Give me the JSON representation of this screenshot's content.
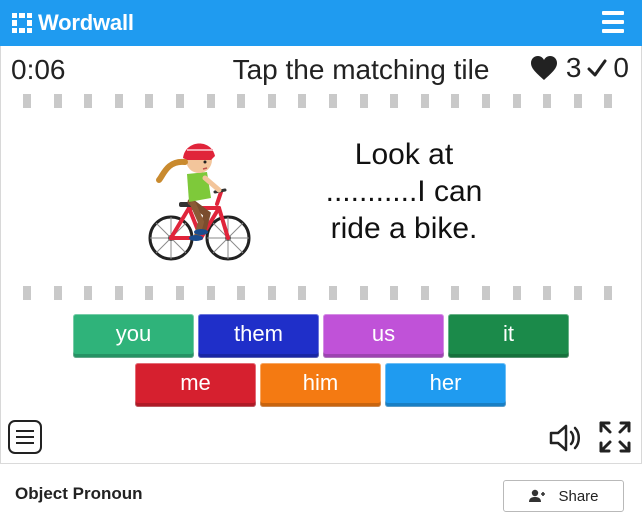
{
  "header": {
    "logo_text": "Wordwall",
    "logo_icon": "wordwall-logo-icon",
    "menu_icon": "hamburger-menu-icon"
  },
  "hud": {
    "timer": "0:06",
    "instruction": "Tap the matching tile",
    "lives": "3",
    "correct": "0",
    "lives_icon": "heart-icon",
    "correct_icon": "checkmark-icon"
  },
  "question": {
    "line1": "Look at",
    "line2": "...........I can",
    "line3": "ride  a bike.",
    "image_icon": "girl-riding-bike-illustration"
  },
  "tiles": [
    {
      "label": "you",
      "color": "#2fb37a"
    },
    {
      "label": "them",
      "color": "#1f2fc9"
    },
    {
      "label": "us",
      "color": "#c052d8"
    },
    {
      "label": "it",
      "color": "#1b8a4a"
    },
    {
      "label": "me",
      "color": "#d6202f"
    },
    {
      "label": "him",
      "color": "#f47a12"
    },
    {
      "label": "her",
      "color": "#1f9bf0"
    }
  ],
  "controls": {
    "menu_icon": "list-menu-icon",
    "sound_icon": "speaker-icon",
    "fullscreen_icon": "fullscreen-icon"
  },
  "footer": {
    "activity_title": "Object Pronoun",
    "share_label": "Share",
    "share_icon": "user-share-icon"
  },
  "colors": {
    "brand": "#1f9bf0",
    "film": "#c9c9c9"
  }
}
